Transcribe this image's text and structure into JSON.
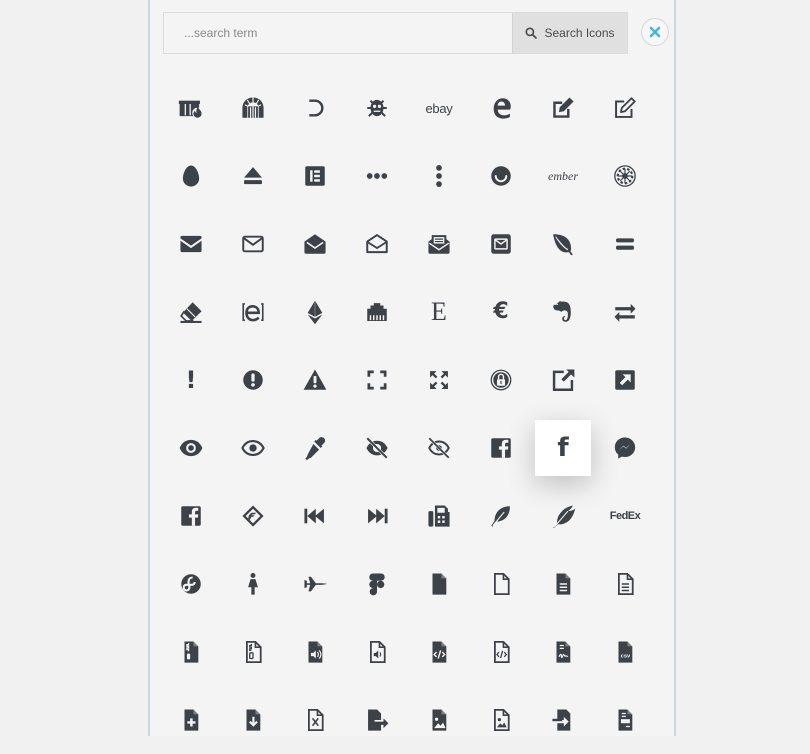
{
  "search": {
    "placeholder": "...search term",
    "button_label": "Search Icons"
  },
  "colors": {
    "icon": "#3d4148",
    "close_accent": "#4ab2e3",
    "panel_border": "#c7d8e6"
  },
  "icons": [
    {
      "name": "dumpster-fire-icon"
    },
    {
      "name": "dungeon-icon"
    },
    {
      "name": "d-and-d-icon"
    },
    {
      "name": "d-and-d-beyond-icon"
    },
    {
      "name": "ebay-icon",
      "text": "ebay"
    },
    {
      "name": "edge-icon"
    },
    {
      "name": "edit-solid-icon"
    },
    {
      "name": "edit-regular-icon"
    },
    {
      "name": "egg-icon"
    },
    {
      "name": "eject-icon"
    },
    {
      "name": "elementor-icon"
    },
    {
      "name": "ellipsis-h-icon"
    },
    {
      "name": "ellipsis-v-icon"
    },
    {
      "name": "ello-icon"
    },
    {
      "name": "ember-icon",
      "text": "ember"
    },
    {
      "name": "empire-icon"
    },
    {
      "name": "envelope-solid-icon"
    },
    {
      "name": "envelope-regular-icon"
    },
    {
      "name": "envelope-open-solid-icon"
    },
    {
      "name": "envelope-open-regular-icon"
    },
    {
      "name": "envelope-open-text-icon"
    },
    {
      "name": "envelope-square-icon"
    },
    {
      "name": "envira-icon"
    },
    {
      "name": "equals-icon"
    },
    {
      "name": "eraser-icon"
    },
    {
      "name": "erlang-icon"
    },
    {
      "name": "ethereum-icon"
    },
    {
      "name": "ethernet-icon"
    },
    {
      "name": "etsy-icon",
      "text": "E"
    },
    {
      "name": "euro-sign-icon",
      "text": "€"
    },
    {
      "name": "evernote-icon"
    },
    {
      "name": "exchange-alt-icon"
    },
    {
      "name": "exclamation-icon",
      "text": "!"
    },
    {
      "name": "exclamation-circle-icon"
    },
    {
      "name": "exclamation-triangle-icon"
    },
    {
      "name": "expand-icon"
    },
    {
      "name": "expand-arrows-alt-icon"
    },
    {
      "name": "expeditedssl-icon"
    },
    {
      "name": "external-link-alt-icon"
    },
    {
      "name": "external-link-square-alt-icon"
    },
    {
      "name": "eye-solid-icon"
    },
    {
      "name": "eye-regular-icon"
    },
    {
      "name": "eye-dropper-icon"
    },
    {
      "name": "eye-slash-solid-icon"
    },
    {
      "name": "eye-slash-regular-icon"
    },
    {
      "name": "facebook-square-icon"
    },
    {
      "name": "facebook-f-icon",
      "text": "f"
    },
    {
      "name": "facebook-messenger-icon"
    },
    {
      "name": "facebook-square-alt-icon"
    },
    {
      "name": "fantasy-flight-games-icon"
    },
    {
      "name": "fast-backward-icon"
    },
    {
      "name": "fast-forward-icon"
    },
    {
      "name": "fax-icon"
    },
    {
      "name": "feather-icon"
    },
    {
      "name": "feather-alt-icon"
    },
    {
      "name": "fedex-icon",
      "text": "FedEx"
    },
    {
      "name": "fedora-icon"
    },
    {
      "name": "female-icon"
    },
    {
      "name": "fighter-jet-icon"
    },
    {
      "name": "figma-icon"
    },
    {
      "name": "file-solid-icon"
    },
    {
      "name": "file-regular-icon"
    },
    {
      "name": "file-alt-solid-icon"
    },
    {
      "name": "file-alt-regular-icon"
    },
    {
      "name": "file-archive-solid-icon"
    },
    {
      "name": "file-archive-regular-icon"
    },
    {
      "name": "file-audio-solid-icon"
    },
    {
      "name": "file-audio-regular-icon"
    },
    {
      "name": "file-code-solid-icon"
    },
    {
      "name": "file-code-regular-icon"
    },
    {
      "name": "file-contract-icon"
    },
    {
      "name": "file-csv-icon",
      "text": "csv"
    },
    {
      "name": "file-medical-icon"
    },
    {
      "name": "file-download-icon"
    },
    {
      "name": "file-excel-regular-icon"
    },
    {
      "name": "file-export-icon"
    },
    {
      "name": "file-image-solid-icon"
    },
    {
      "name": "file-image-regular-icon"
    },
    {
      "name": "file-import-icon"
    },
    {
      "name": "file-invoice-icon"
    }
  ],
  "active_icon": "facebook-f-icon"
}
